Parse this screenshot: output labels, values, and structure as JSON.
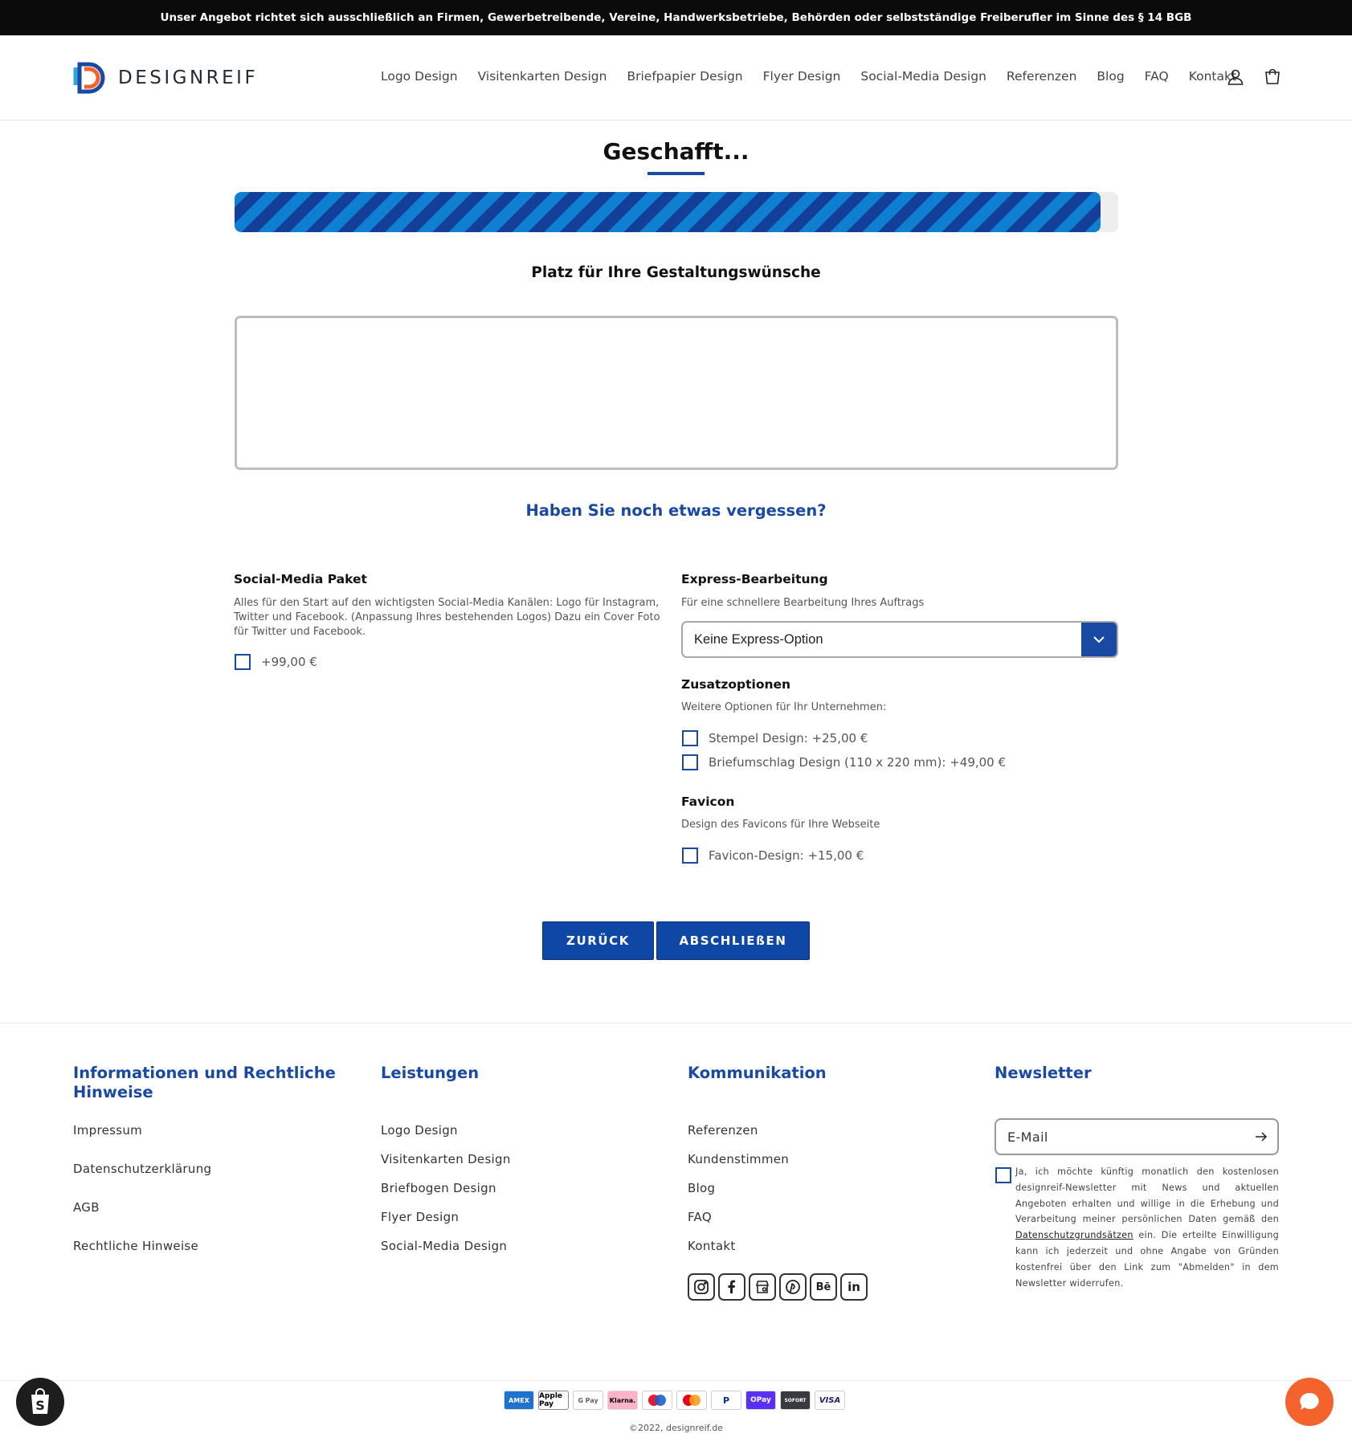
{
  "announcement": "Unser Angebot richtet sich ausschließlich an Firmen, Gewerbetreibende, Vereine, Handwerksbetriebe, Behörden oder selbstständige Freiberufler im Sinne des § 14 BGB",
  "header": {
    "logo_text": "DESIGNREIF",
    "nav": [
      "Logo Design",
      "Visitenkarten Design",
      "Briefpapier Design",
      "Flyer Design",
      "Social-Media Design",
      "Referenzen",
      "Blog",
      "FAQ",
      "Kontakt"
    ],
    "icons": [
      "user-icon",
      "cart-icon"
    ]
  },
  "main": {
    "title": "Geschafft...",
    "progress_percent": 98,
    "wishes_heading": "Platz für Ihre Gestaltungswünsche",
    "wishes_value": "",
    "forgot_heading": "Haben Sie noch etwas vergessen?",
    "social_media": {
      "title": "Social-Media Paket",
      "description": "Alles für den Start auf den wichtigsten Social-Media Kanälen: Logo für Instagram, Twitter und Facebook. (Anpassung Ihres bestehenden Logos) Dazu ein Cover Foto für Twitter und Facebook.",
      "option": "+99,00 €"
    },
    "express": {
      "title": "Express-Bearbeitung",
      "description": "Für eine schnellere Bearbeitung Ihres Auftrags",
      "selected": "Keine Express-Option"
    },
    "extras": {
      "title": "Zusatzoptionen",
      "description": "Weitere Optionen für Ihr Unternehmen:",
      "options": [
        "Stempel Design: +25,00 €",
        "Briefumschlag Design (110 x 220 mm): +49,00 €"
      ]
    },
    "favicon": {
      "title": "Favicon",
      "description": "Design des Favicons für Ihre Webseite",
      "option": "Favicon-Design: +15,00 €"
    },
    "back_button": "ZURÜCK",
    "finish_button": "ABSCHLIEßEN"
  },
  "footer": {
    "info": {
      "heading": "Informationen und Rechtliche Hinweise",
      "links": [
        "Impressum",
        "Datenschutzerklärung",
        "AGB",
        "Rechtliche Hinweise"
      ]
    },
    "services": {
      "heading": "Leistungen",
      "links": [
        "Logo Design",
        "Visitenkarten Design",
        "Briefbogen Design",
        "Flyer Design",
        "Social-Media Design"
      ]
    },
    "communication": {
      "heading": "Kommunikation",
      "links": [
        "Referenzen",
        "Kundenstimmen",
        "Blog",
        "FAQ",
        "Kontakt"
      ],
      "social_icons": [
        "instagram-icon",
        "facebook-icon",
        "google-business-icon",
        "pinterest-icon",
        "behance-icon",
        "linkedin-icon"
      ]
    },
    "newsletter": {
      "heading": "Newsletter",
      "email_placeholder": "E-Mail",
      "consent_before": "Ja, ich möchte künftig monatlich den kostenlosen designreif-Newsletter mit News und aktuellen Angeboten erhalten und willige in die Erhebung und Verarbeitung meiner persönlichen Daten gemäß den ",
      "consent_link": "Datenschutzgrundsätzen",
      "consent_after": " ein. Die erteilte Einwilligung kann ich jederzeit und ohne Angabe von Gründen kostenfrei über den Link zum \"Abmelden\" in dem Newsletter widerrufen."
    },
    "payments": [
      "AMEX",
      "Apple Pay",
      "G Pay",
      "Klarna.",
      "Maestro",
      "Mastercard",
      "PayPal",
      "Shop Pay",
      "SOFORT",
      "VISA"
    ],
    "copyright": "©2022, designreif.de"
  },
  "colors": {
    "brand_blue": "#1a49a3",
    "button_blue": "#0f47a6",
    "stripe_light": "#0f7fd1",
    "stripe_dark": "#143f99",
    "chat_orange": "#f3632b"
  }
}
